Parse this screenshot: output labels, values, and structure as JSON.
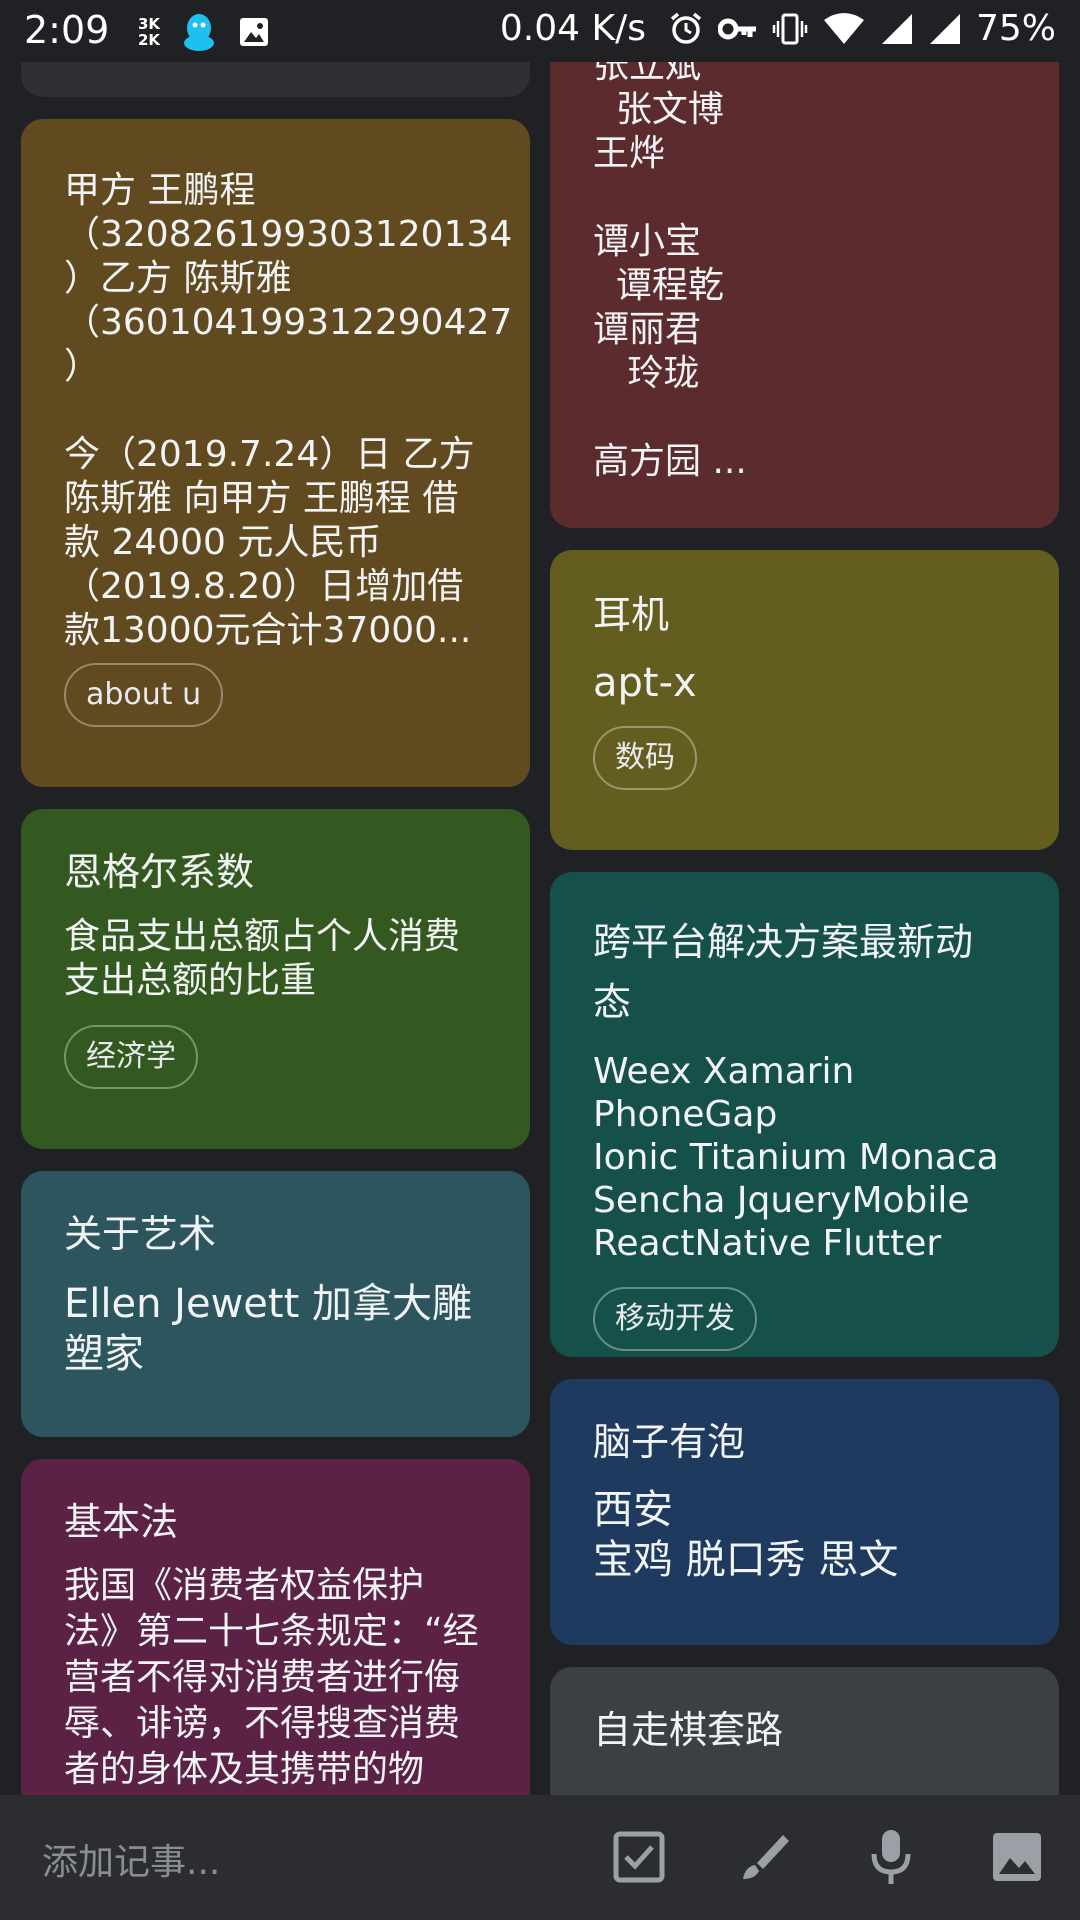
{
  "status_bar": {
    "time": "2:09",
    "data_top": "3K",
    "data_bottom": "2K",
    "net_speed": "0.04 K/s",
    "battery": "75%"
  },
  "notes": {
    "top_left_stub": {},
    "loan": {
      "body": "甲方 王鹏程\n（320826199303120134\n）乙方 陈斯雅\n（360104199312290427\n）\n\n今（2019.7.24）日 乙方\n陈斯雅 向甲方 王鹏程 借\n款 24000 元人民币\n（2019.8.20）日增加借\n款13000元合计37000...",
      "label": "about u"
    },
    "names": {
      "body": "张立斌\n  张文博\n王烨\n\n谭小宝\n  谭程乾\n谭丽君\n   玲珑\n\n高方园 ..."
    },
    "earphone": {
      "title": "耳机",
      "body": "apt-x",
      "label": "数码"
    },
    "engel": {
      "title": "恩格尔系数",
      "body": "食品支出总额占个人消费\n支出总额的比重",
      "label": "经济学"
    },
    "cross_platform": {
      "title": "跨平台解决方案最新动\n态",
      "body": "Weex Xamarin PhoneGap\nIonic Titanium Monaca\nSencha JqueryMobile\nReactNative Flutter",
      "label": "移动开发"
    },
    "art": {
      "title": "关于艺术",
      "body": "Ellen Jewett 加拿大雕\n塑家"
    },
    "brain": {
      "title": "脑子有泡",
      "body": "西安\n宝鸡 脱口秀 思文"
    },
    "basic_law": {
      "title": "基本法",
      "body": "我国《消费者权益保护\n法》第二十七条规定：“经\n营者不得对消费者进行侮\n辱、诽谤，不得搜查消费\n者的身体及其携带的物"
    },
    "chess": {
      "title": "自走棋套路"
    }
  },
  "bottom_bar": {
    "placeholder": "添加记事..."
  },
  "icons": {
    "checkbox": "checkbox-icon",
    "brush": "brush-icon",
    "mic": "mic-icon",
    "image": "image-icon"
  },
  "colors": {
    "background": "#202124",
    "brown": "#614a1f",
    "maroon": "#5c2b2e",
    "olive": "#635d1f",
    "green": "#345920",
    "teal": "#16504b",
    "slate": "#2d555e",
    "navy": "#1e3a5f",
    "purple": "#5b2245",
    "gray": "#3c3f43"
  }
}
